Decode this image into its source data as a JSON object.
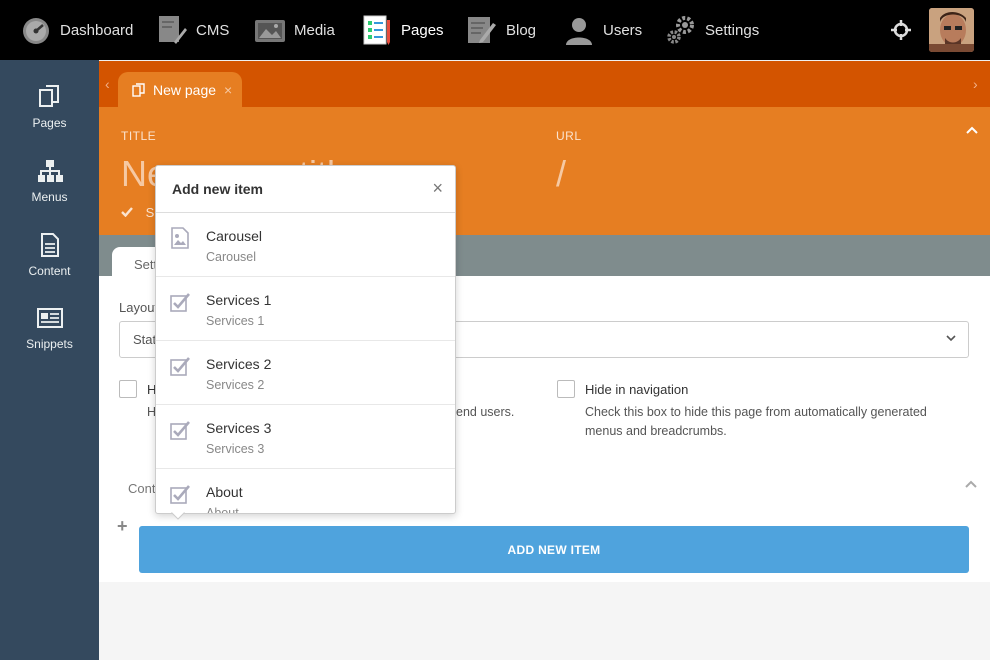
{
  "topnav": {
    "items": [
      {
        "label": "Dashboard",
        "icon": "dashboard-icon"
      },
      {
        "label": "CMS",
        "icon": "cms-icon"
      },
      {
        "label": "Media",
        "icon": "media-icon"
      },
      {
        "label": "Pages",
        "icon": "pages-icon"
      },
      {
        "label": "Blog",
        "icon": "blog-icon"
      },
      {
        "label": "Users",
        "icon": "users-icon"
      },
      {
        "label": "Settings",
        "icon": "settings-icon"
      }
    ]
  },
  "sidebar": {
    "items": [
      {
        "label": "Pages",
        "icon": "pages-icon"
      },
      {
        "label": "Menus",
        "icon": "sitemap-icon"
      },
      {
        "label": "Content",
        "icon": "document-icon"
      },
      {
        "label": "Snippets",
        "icon": "newspaper-icon"
      }
    ]
  },
  "tab": {
    "label": "New page",
    "close": "×"
  },
  "header": {
    "title_label": "TITLE",
    "title_value": "Ne",
    "title_value_tail": "titl",
    "url_label": "URL",
    "url_value": "/",
    "saved_text": "S"
  },
  "settings_tab": {
    "label": "Sett"
  },
  "form": {
    "layout_label": "Layout",
    "layout_value": "Stat",
    "hide_label": "H",
    "hide_help_prefix": "H",
    "hide_help_suffix": "end users.",
    "hide_nav_label": "Hide in navigation",
    "hide_nav_help": "Check this box to hide this page from automatically generated menus and breadcrumbs.",
    "content_label": "Cont"
  },
  "add_button": {
    "label": "ADD NEW ITEM",
    "plus": "+"
  },
  "popover": {
    "title": "Add new item",
    "close": "×",
    "items": [
      {
        "name": "Carousel",
        "sub": "Carousel",
        "icon": "image-icon"
      },
      {
        "name": "Services 1",
        "sub": "Services 1",
        "icon": "check-icon"
      },
      {
        "name": "Services 2",
        "sub": "Services 2",
        "icon": "check-icon"
      },
      {
        "name": "Services 3",
        "sub": "Services 3",
        "icon": "check-icon"
      },
      {
        "name": "About",
        "sub": "About",
        "icon": "check-icon"
      }
    ]
  },
  "colors": {
    "topbar": "#000000",
    "sidebar": "#34495e",
    "tabstrip": "#d35400",
    "header": "#e67e22",
    "greystrip": "#7f8c8d",
    "accent_button": "#4fa3dd"
  }
}
